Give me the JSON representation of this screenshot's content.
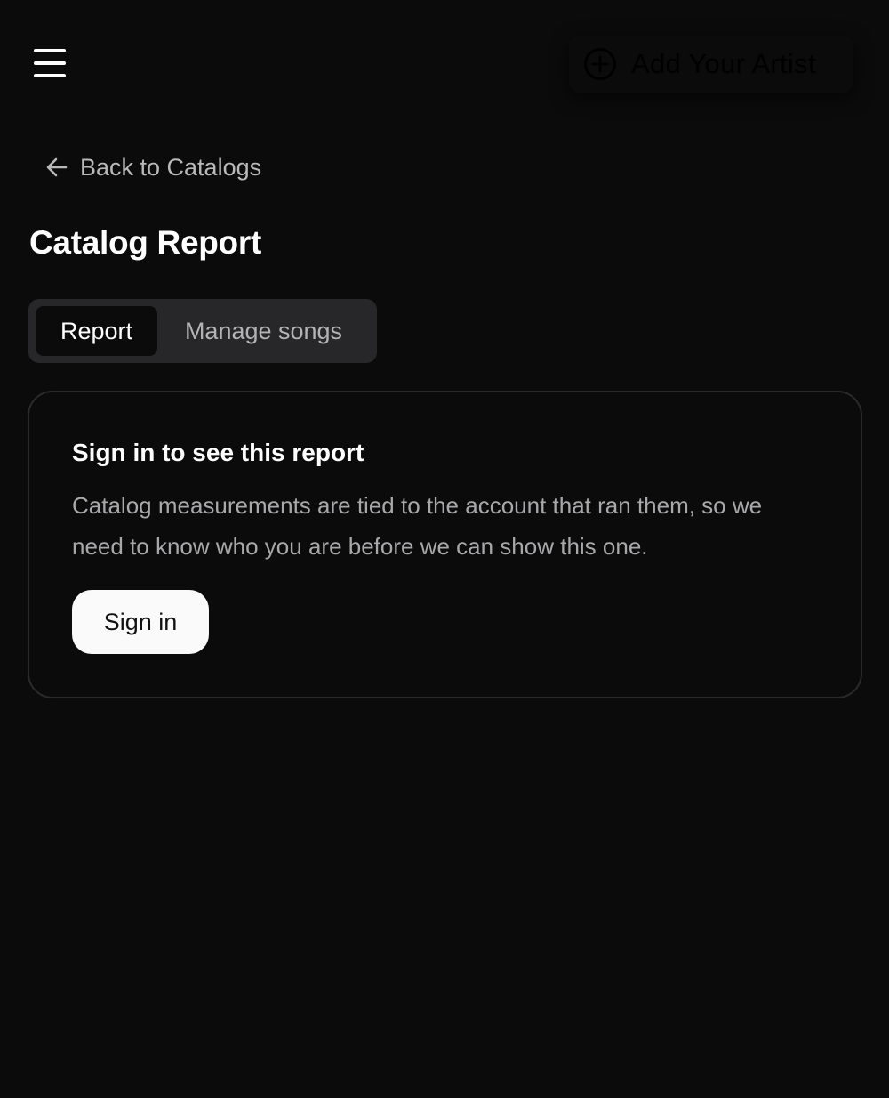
{
  "header": {
    "menu_icon": "hamburger-menu-icon",
    "add_artist_label": "Add Your Artist",
    "add_artist_icon": "plus-circle-icon"
  },
  "navigation": {
    "back_label": "Back to Catalogs",
    "back_icon": "arrow-left-icon"
  },
  "page": {
    "title": "Catalog Report"
  },
  "tabs": [
    {
      "label": "Report",
      "active": true
    },
    {
      "label": "Manage songs",
      "active": false
    }
  ],
  "card": {
    "title": "Sign in to see this report",
    "body": "Catalog measurements are tied to the account that ran them, so we need to know who you are before we can show this one.",
    "signin_label": "Sign in"
  },
  "colors": {
    "background": "#0b0b0b",
    "tab_track": "#27272a",
    "muted_text": "#a8a8ab",
    "button_bg": "#fafafa"
  }
}
